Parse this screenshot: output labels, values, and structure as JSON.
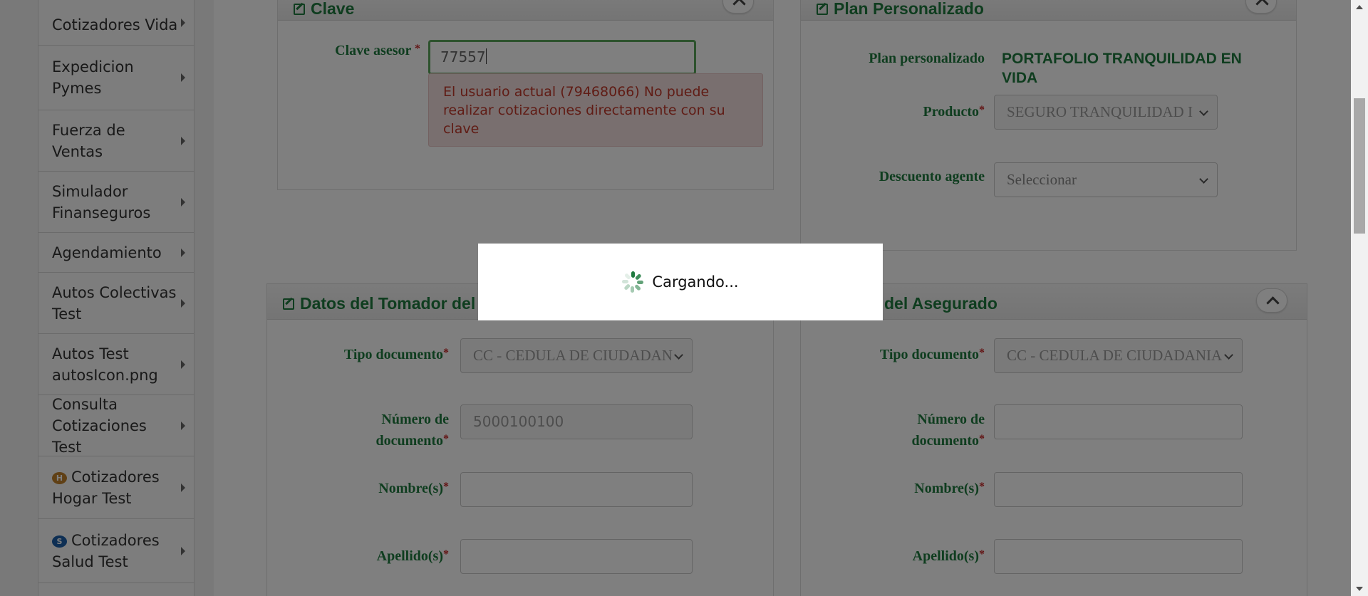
{
  "sidebar": {
    "items": [
      {
        "label": "Cotizadores Vida",
        "icon": ""
      },
      {
        "label": "Expedicion Pymes",
        "icon": ""
      },
      {
        "label": "Fuerza de Ventas",
        "icon": ""
      },
      {
        "label": "Simulador Finanseguros",
        "icon": ""
      },
      {
        "label": "Agendamiento",
        "icon": ""
      },
      {
        "label": "Autos Colectivas Test",
        "icon": ""
      },
      {
        "label": "Autos Test autosIcon.png",
        "icon": ""
      },
      {
        "label": "Consulta Cotizaciones Test",
        "icon": ""
      },
      {
        "label": "Cotizadores Hogar Test",
        "icon": "hogar-badge-icon",
        "badge": "H",
        "badge_color": "#c0812a"
      },
      {
        "label": "Cotizadores Salud Test",
        "icon": "salud-badge-icon",
        "badge": "S",
        "badge_color": "#1d5fa8"
      }
    ]
  },
  "clave_panel": {
    "title": "Clave",
    "clave_label": "Clave asesor",
    "clave_value": "77557",
    "error_message": "El usuario actual (79468066) No puede realizar cotizaciones directamente con su clave"
  },
  "plan_panel": {
    "title": "Plan Personalizado",
    "plan_label": "Plan personalizado",
    "plan_value": "PORTAFOLIO TRANQUILIDAD EN VIDA",
    "producto_label": "Producto",
    "producto_value": "SEGURO TRANQUILIDAD I",
    "descuento_label": "Descuento agente",
    "descuento_value": "Seleccionar"
  },
  "tomador_panel": {
    "title": "Datos del Tomador del",
    "tipo_doc_label": "Tipo documento",
    "tipo_doc_value": "CC - CEDULA DE CIUDADAN",
    "num_doc_label_1": "Número de",
    "num_doc_label_2": "documento",
    "num_doc_value": "5000100100",
    "nombre_label": "Nombre(s)",
    "nombre_value": "",
    "apellido_label": "Apellido(s)",
    "apellido_value": ""
  },
  "asegurado_panel": {
    "title": "del Asegurado",
    "tipo_doc_label": "Tipo documento",
    "tipo_doc_value": "CC - CEDULA DE CIUDADANIA",
    "num_doc_label_1": "Número de",
    "num_doc_label_2": "documento",
    "num_doc_value": "",
    "nombre_label": "Nombre(s)",
    "nombre_value": "",
    "apellido_label": "Apellido(s)",
    "apellido_value": ""
  },
  "loading": {
    "text": "Cargando..."
  },
  "required_marker": "*",
  "colors": {
    "accent_green": "#1f7a3f",
    "error_red": "#c0392b",
    "error_bg": "#f2dede",
    "focus_border": "#5aa55a"
  }
}
